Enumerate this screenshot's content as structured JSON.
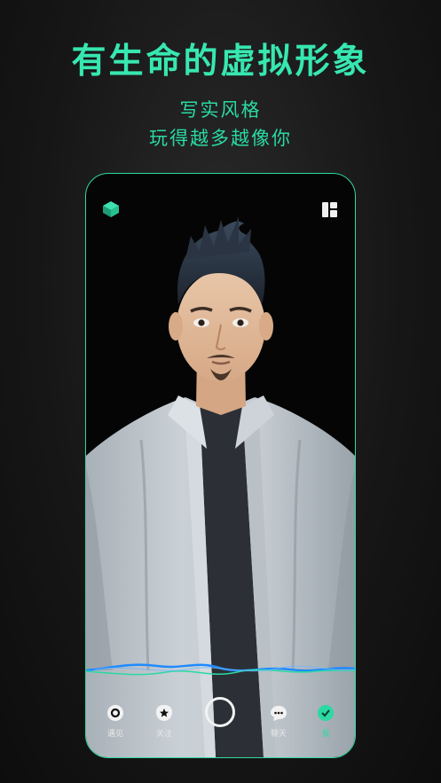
{
  "promo": {
    "headline": "有生命的虚拟形象",
    "sub_line_1": "写实风格",
    "sub_line_2": "玩得越多越像你"
  },
  "top_icons": {
    "left": "cube-logo-icon",
    "right": "layout-grid-icon"
  },
  "tabs": [
    {
      "label": "遇见",
      "icon": "discover-icon"
    },
    {
      "label": "关注",
      "icon": "star-icon"
    },
    {
      "label": "",
      "icon": "capture-ring-icon"
    },
    {
      "label": "聊天",
      "icon": "chat-bubble-icon"
    },
    {
      "label": "我",
      "icon": "profile-icon"
    }
  ],
  "colors": {
    "accent": "#37e7b0",
    "background": "#171717",
    "wave_primary": "#1f8bff",
    "wave_secondary": "#2bd9a3"
  }
}
